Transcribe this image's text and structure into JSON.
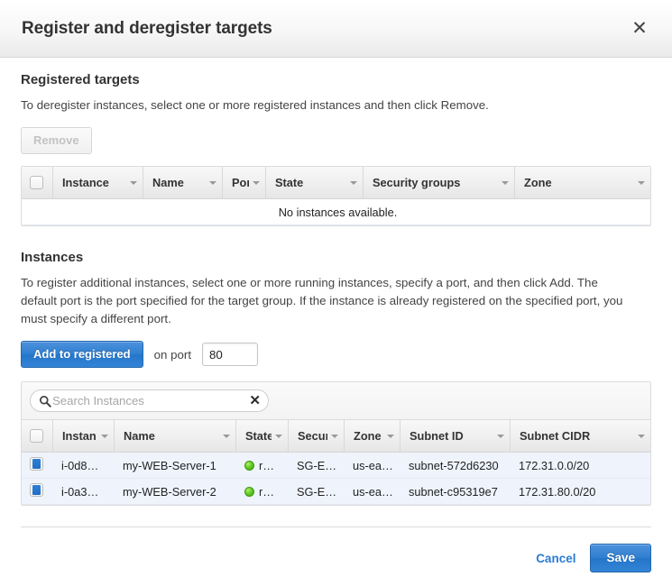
{
  "dialog": {
    "title": "Register and deregister targets",
    "close_icon": "close-icon"
  },
  "registered": {
    "heading": "Registered targets",
    "description": "To deregister instances, select one or more registered instances and then click Remove.",
    "remove_label": "Remove",
    "remove_disabled": true,
    "columns": [
      "Instance",
      "Name",
      "Port",
      "State",
      "Security groups",
      "Zone"
    ],
    "empty_message": "No instances available.",
    "rows": []
  },
  "instances": {
    "heading": "Instances",
    "description": "To register additional instances, select one or more running instances, specify a port, and then click Add. The default port is the port specified for the target group. If the instance is already registered on the specified port, you must specify a different port.",
    "add_label": "Add to registered",
    "on_port_label": "on port",
    "port_value": "80",
    "search": {
      "placeholder": "Search Instances",
      "value": "",
      "search_icon": "search-icon",
      "clear_icon": "clear-icon"
    },
    "columns": [
      "Instan",
      "Name",
      "State",
      "Secur",
      "Zone",
      "Subnet ID",
      "Subnet CIDR"
    ],
    "rows": [
      {
        "selected": true,
        "instance": "i-0d8…",
        "name": "my-WEB-Server-1",
        "state": "r…",
        "state_color": "#63cc27",
        "security_groups": "SG-E…",
        "zone": "us-ea…",
        "subnet_id": "subnet-572d6230",
        "subnet_cidr": "172.31.0.0/20"
      },
      {
        "selected": true,
        "instance": "i-0a3…",
        "name": "my-WEB-Server-2",
        "state": "r…",
        "state_color": "#63cc27",
        "security_groups": "SG-E…",
        "zone": "us-ea…",
        "subnet_id": "subnet-c95319e7",
        "subnet_cidr": "172.31.80.0/20"
      }
    ]
  },
  "footer": {
    "cancel_label": "Cancel",
    "save_label": "Save"
  },
  "colors": {
    "primary": "#2f7ed0",
    "link": "#2b7cd3",
    "status_running": "#63cc27"
  }
}
